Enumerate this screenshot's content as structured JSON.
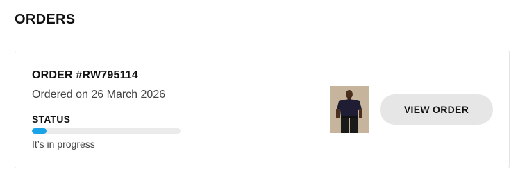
{
  "page": {
    "title": "ORDERS"
  },
  "order": {
    "number": "ORDER #RW795114",
    "ordered_on": "Ordered on 26 March 2026",
    "status_label": "STATUS",
    "status_text": "It’s in progress",
    "progress_fraction": 0.1,
    "view_order_label": "VIEW ORDER",
    "product_image_alt": "product-thumbnail"
  },
  "colors": {
    "progress_fill": "#1aa3e6",
    "progress_track": "#ebebeb",
    "button_bg": "#e6e6e6"
  }
}
